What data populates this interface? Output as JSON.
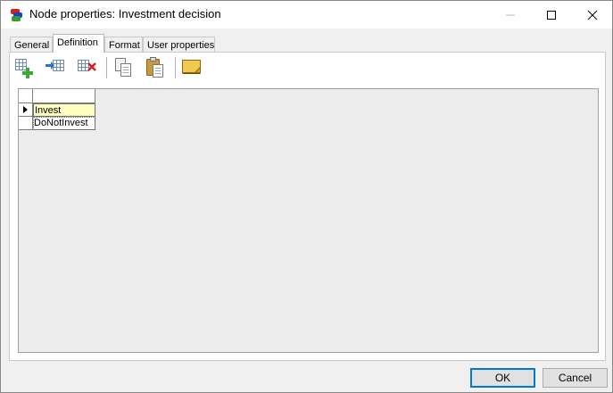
{
  "window": {
    "title": "Node properties: Investment decision"
  },
  "tabs": [
    {
      "label": "General",
      "active": false
    },
    {
      "label": "Definition",
      "active": true
    },
    {
      "label": "Format",
      "active": false
    },
    {
      "label": "User properties",
      "active": false
    }
  ],
  "toolbar": {
    "buttons": [
      {
        "icon": "add-row-icon"
      },
      {
        "icon": "insert-row-icon"
      },
      {
        "icon": "delete-row-icon"
      },
      {
        "icon": "copy-icon"
      },
      {
        "icon": "paste-icon"
      },
      {
        "icon": "note-icon"
      }
    ]
  },
  "grid": {
    "rows": [
      {
        "value": "Invest",
        "current": true
      },
      {
        "value": "DoNotInvest",
        "current": false
      }
    ]
  },
  "buttons": {
    "ok": "OK",
    "cancel": "Cancel"
  },
  "colors": {
    "selected_cell": "#ffffc0",
    "default_button_border": "#0078d7"
  }
}
